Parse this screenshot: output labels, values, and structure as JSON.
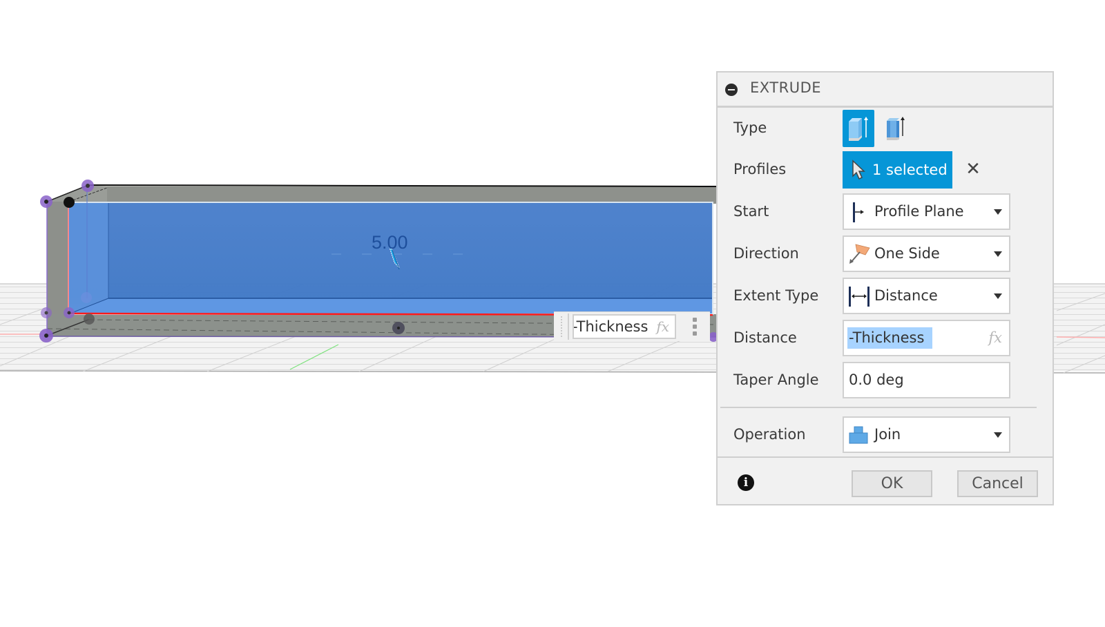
{
  "viewport": {
    "dimension_value": "5.00",
    "floating_input": {
      "value": "-Thickness",
      "fx_label": "fx"
    },
    "colors": {
      "profile_fill": "#4a80cc",
      "body_gray": "#8e918c",
      "selection_red": "#ff1a1a",
      "handle_purple": "#8a63c9",
      "grid_green": "#5fe05f"
    }
  },
  "dialog": {
    "title": "EXTRUDE",
    "rows": {
      "type": {
        "label": "Type",
        "options": [
          "One Side Solid",
          "Thin Extrude"
        ],
        "selected": 0
      },
      "profiles": {
        "label": "Profiles",
        "button_label": "1 selected",
        "clear_icon": "close-icon"
      },
      "start": {
        "label": "Start",
        "value": "Profile Plane"
      },
      "direction": {
        "label": "Direction",
        "value": "One Side"
      },
      "extent_type": {
        "label": "Extent Type",
        "value": "Distance"
      },
      "distance": {
        "label": "Distance",
        "value": "-Thickness",
        "fx_label": "fx"
      },
      "taper_angle": {
        "label": "Taper Angle",
        "value": "0.0 deg"
      },
      "operation": {
        "label": "Operation",
        "value": "Join"
      }
    },
    "footer": {
      "ok_label": "OK",
      "cancel_label": "Cancel"
    },
    "colors": {
      "accent": "#0696d7",
      "selection_highlight": "#a7d3ff",
      "panel_bg": "#f1f1f1"
    }
  }
}
